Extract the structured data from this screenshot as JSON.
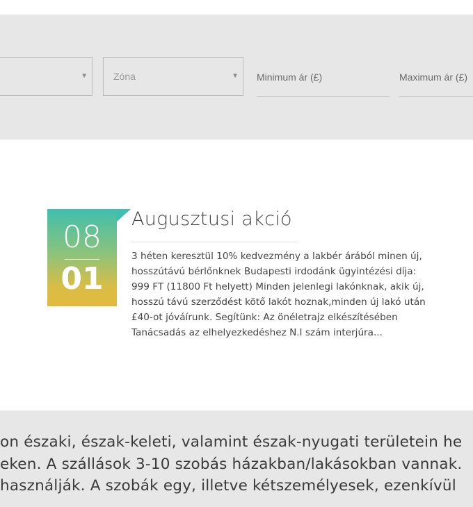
{
  "filters": {
    "select_1": {
      "caret": "▼"
    },
    "zone_select": {
      "placeholder": "Zóna",
      "caret": "▼"
    },
    "min_price": {
      "placeholder": "Minimum ár (£)"
    },
    "max_price": {
      "placeholder": "Maximum ár (£)"
    }
  },
  "post": {
    "month": "08",
    "day": "01",
    "title": "Augusztusi akció",
    "excerpt_lines": [
      "3 héten keresztül 10% kedvezmény a lakbér árából minen új,",
      "hosszútávú bérlőnknek Budapesti irdodánk ügyintézési díja:",
      "999 FT (11800 Ft helyett) Minden jelenlegi lakónknak, akik új,",
      "hosszú távú szerződést kötő lakót hoznak,minden új lakó után",
      "£40-ot jóváírunk. Segítünk: Az önéletrajz elkészítésében",
      "Tanácsadás az elhelyezkedéshez N.I szám interjúra..."
    ]
  },
  "intro": {
    "lines": [
      "on északi, észak-keleti, valamint észak-nyugati területein he",
      "eken. A szállások 3-10 szobás házakban/lakásokban vannak.",
      " használják. A szobák egy, illetve kétszemélyesek, ezenkívül"
    ]
  },
  "colors": {
    "band_grey": "#e7e7e7",
    "badge_top": "#3fbfad",
    "badge_bottom": "#e1ba3f"
  }
}
